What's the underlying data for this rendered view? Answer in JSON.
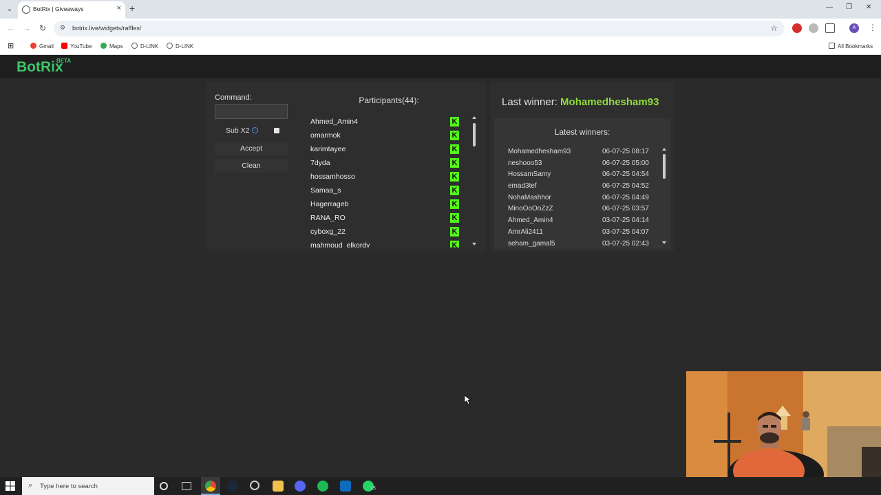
{
  "browser": {
    "tab_title": "BotRix | Giveaways",
    "url": "botrix.live/widgets/raffles/",
    "bookmarks": [
      "Gmail",
      "YouTube",
      "Maps",
      "D-LINK",
      "D-LINK"
    ],
    "all_bookmarks": "All Bookmarks",
    "profile_initial": "A"
  },
  "app": {
    "logo": "BotRix",
    "logo_badge": "BETA"
  },
  "raffle": {
    "command_label": "Command:",
    "command_value": "",
    "sub_x2_label": "Sub X2",
    "accept_label": "Accept",
    "clean_label": "Clean"
  },
  "participants": {
    "title": "Participants(44):",
    "items": [
      "Ahmed_Amin4",
      "omarmok",
      "karimtayee",
      "7dyda",
      "hossamhosso",
      "Samaa_s",
      "Hagerrageb",
      "RANA_RO",
      "cyboxg_22",
      "mahmoud_elkordy"
    ],
    "platform_icon": "kick-icon",
    "platform_color": "#53fc18"
  },
  "winners": {
    "last_winner_label": "Last winner:",
    "last_winner_name": "Mohamedhesham93",
    "latest_title": "Latest winners:",
    "items": [
      {
        "name": "Mohamedhesham93",
        "date": "06-07-25 08:17"
      },
      {
        "name": "neshooo53",
        "date": "06-07-25 05:00"
      },
      {
        "name": "HossamSamy",
        "date": "06-07-25 04:54"
      },
      {
        "name": "emad3tef",
        "date": "06-07-25 04:52"
      },
      {
        "name": "NohaMashhor",
        "date": "06-07-25 04:49"
      },
      {
        "name": "MinoOoOoZzZ",
        "date": "06-07-25 03:57"
      },
      {
        "name": "Ahmed_Amin4",
        "date": "03-07-25 04:14"
      },
      {
        "name": "AmrAli2411",
        "date": "03-07-25 04:07"
      },
      {
        "name": "seham_gamal5",
        "date": "03-07-25 02:43"
      }
    ]
  },
  "taskbar": {
    "search_placeholder": "Type here to search",
    "whatsapp_badge": "15"
  },
  "colors": {
    "accent_green": "#3fc66a",
    "winner_green": "#8fdc3a",
    "kick_green": "#53fc18"
  }
}
